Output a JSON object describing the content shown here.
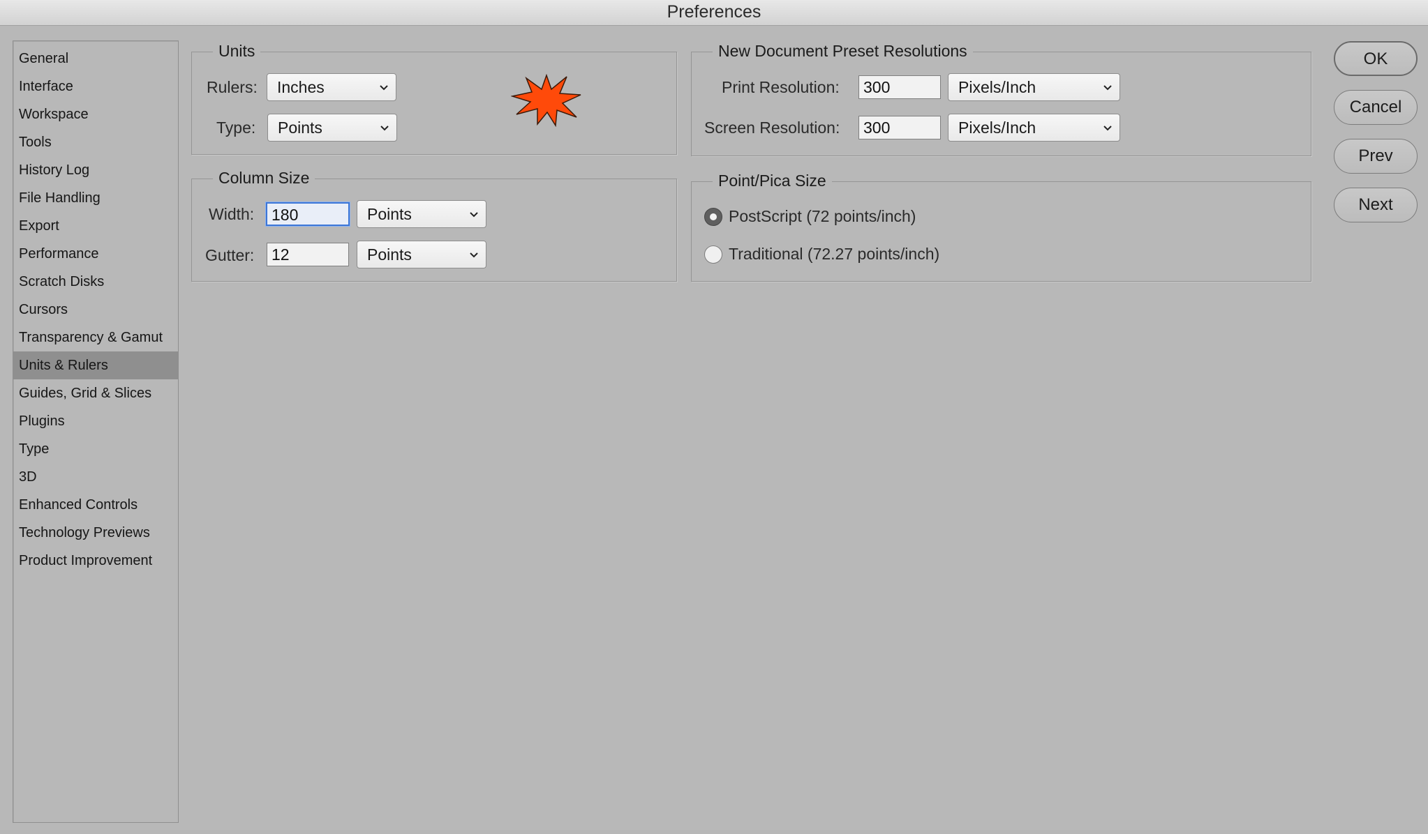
{
  "window": {
    "title": "Preferences"
  },
  "sidebar": {
    "items": [
      "General",
      "Interface",
      "Workspace",
      "Tools",
      "History Log",
      "File Handling",
      "Export",
      "Performance",
      "Scratch Disks",
      "Cursors",
      "Transparency & Gamut",
      "Units & Rulers",
      "Guides, Grid & Slices",
      "Plugins",
      "Type",
      "3D",
      "Enhanced Controls",
      "Technology Previews",
      "Product Improvement"
    ],
    "selected_index": 11
  },
  "units": {
    "title": "Units",
    "rulers_label": "Rulers:",
    "rulers_value": "Inches",
    "type_label": "Type:",
    "type_value": "Points"
  },
  "column_size": {
    "title": "Column Size",
    "width_label": "Width:",
    "width_value": "180",
    "width_unit": "Points",
    "gutter_label": "Gutter:",
    "gutter_value": "12",
    "gutter_unit": "Points"
  },
  "presets": {
    "title": "New Document Preset Resolutions",
    "print_label": "Print Resolution:",
    "print_value": "300",
    "print_unit": "Pixels/Inch",
    "screen_label": "Screen Resolution:",
    "screen_value": "300",
    "screen_unit": "Pixels/Inch"
  },
  "point_pica": {
    "title": "Point/Pica Size",
    "option_postscript": "PostScript (72 points/inch)",
    "option_traditional": "Traditional (72.27 points/inch)",
    "selected": "postscript"
  },
  "buttons": {
    "ok": "OK",
    "cancel": "Cancel",
    "prev": "Prev",
    "next": "Next"
  },
  "colors": {
    "starburst": "#ff4a0a",
    "focus_ring": "#3d76d6",
    "selected_item": "#8f8f8f"
  },
  "icons": {
    "select_arrow": "chevron-down-icon",
    "decoration": "starburst-icon"
  }
}
